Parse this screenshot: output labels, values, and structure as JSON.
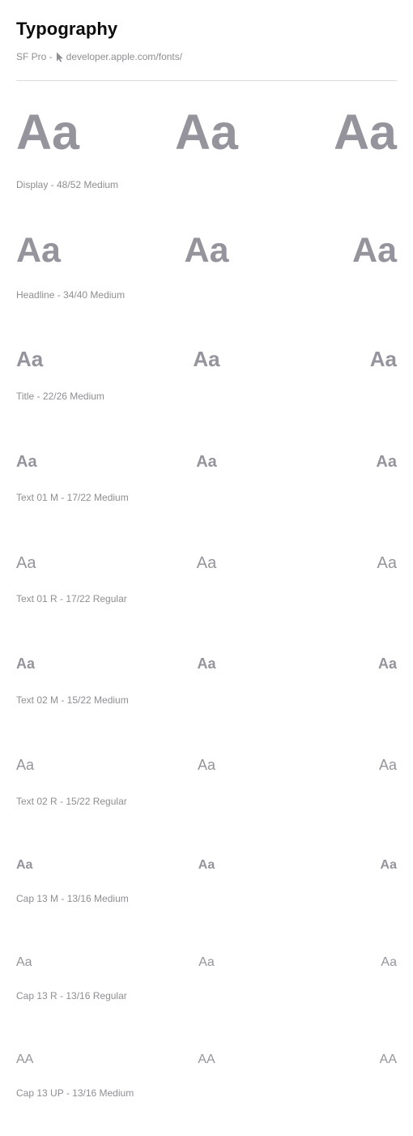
{
  "header": {
    "title": "Typography",
    "font_name": "SF Pro -",
    "link_text": "developer.apple.com/fonts/"
  },
  "icons": {
    "cursor": "cursor-arrow-icon"
  },
  "colors": {
    "title": "#0c0c0c",
    "sample": "#95949c",
    "label": "#8e8e93",
    "divider": "#dcdcdf"
  },
  "styles": [
    {
      "id": "display",
      "samples": [
        "Aa",
        "Aa",
        "Aa"
      ],
      "label": "Display - 48/52 Medium"
    },
    {
      "id": "headline",
      "samples": [
        "Aa",
        "Aa",
        "Aa"
      ],
      "label": "Headline - 34/40 Medium"
    },
    {
      "id": "title",
      "samples": [
        "Aa",
        "Aa",
        "Aa"
      ],
      "label": "Title - 22/26 Medium"
    },
    {
      "id": "text-01-m",
      "samples": [
        "Aa",
        "Aa",
        "Aa"
      ],
      "label": "Text 01 M - 17/22 Medium"
    },
    {
      "id": "text-01-r",
      "samples": [
        "Aa",
        "Aa",
        "Aa"
      ],
      "label": "Text 01 R - 17/22 Regular"
    },
    {
      "id": "text-02-m",
      "samples": [
        "Aa",
        "Aa",
        "Aa"
      ],
      "label": "Text 02 M - 15/22 Medium"
    },
    {
      "id": "text-02-r",
      "samples": [
        "Aa",
        "Aa",
        "Aa"
      ],
      "label": "Text 02 R - 15/22 Regular"
    },
    {
      "id": "cap-13-m",
      "samples": [
        "Aa",
        "Aa",
        "Aa"
      ],
      "label": "Cap 13 M - 13/16 Medium"
    },
    {
      "id": "cap-13-r",
      "samples": [
        "Aa",
        "Aa",
        "Aa"
      ],
      "label": "Cap 13 R - 13/16 Regular"
    },
    {
      "id": "cap-13-up",
      "samples": [
        "AA",
        "AA",
        "AA"
      ],
      "label": "Cap 13 UP - 13/16 Medium"
    }
  ]
}
